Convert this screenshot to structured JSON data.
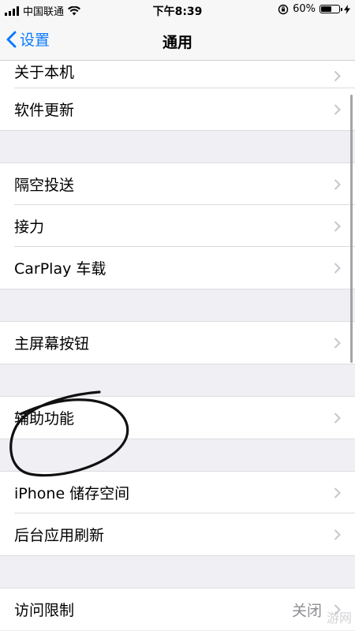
{
  "status_bar": {
    "carrier": "中国联通",
    "time": "下午8:39",
    "battery": "60%",
    "battery_level": 0.6
  },
  "nav": {
    "back_label": "设置",
    "title": "通用"
  },
  "rows": {
    "about": "关于本机",
    "software_update": "软件更新",
    "airdrop": "隔空投送",
    "handoff": "接力",
    "carplay": "CarPlay 车载",
    "home_button": "主屏幕按钮",
    "accessibility": "辅助功能",
    "iphone_storage": "iPhone 储存空间",
    "background_refresh": "后台应用刷新",
    "restrictions": "访问限制",
    "restrictions_value": "关闭"
  },
  "watermark": "游网"
}
